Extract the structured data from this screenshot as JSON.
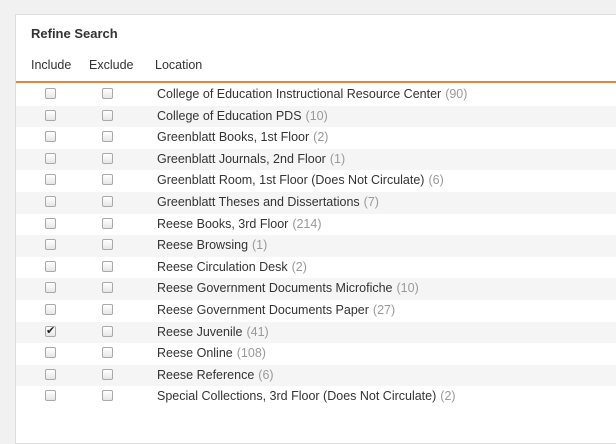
{
  "panel": {
    "title": "Refine Search",
    "columns": {
      "include": "Include",
      "exclude": "Exclude",
      "location": "Location"
    },
    "accent_color": "#e9813f",
    "rows": [
      {
        "label": "College of Education Instructional Resource Center",
        "count": "(90)",
        "include": false,
        "exclude": false
      },
      {
        "label": "College of Education PDS",
        "count": "(10)",
        "include": false,
        "exclude": false
      },
      {
        "label": "Greenblatt Books, 1st Floor",
        "count": "(2)",
        "include": false,
        "exclude": false
      },
      {
        "label": "Greenblatt Journals, 2nd Floor",
        "count": "(1)",
        "include": false,
        "exclude": false
      },
      {
        "label": "Greenblatt Room, 1st Floor (Does Not Circulate)",
        "count": "(6)",
        "include": false,
        "exclude": false
      },
      {
        "label": "Greenblatt Theses and Dissertations",
        "count": "(7)",
        "include": false,
        "exclude": false
      },
      {
        "label": "Reese Books, 3rd Floor",
        "count": "(214)",
        "include": false,
        "exclude": false
      },
      {
        "label": "Reese Browsing",
        "count": "(1)",
        "include": false,
        "exclude": false
      },
      {
        "label": "Reese Circulation Desk",
        "count": "(2)",
        "include": false,
        "exclude": false
      },
      {
        "label": "Reese Government Documents Microfiche",
        "count": "(10)",
        "include": false,
        "exclude": false
      },
      {
        "label": "Reese Government Documents Paper",
        "count": "(27)",
        "include": false,
        "exclude": false
      },
      {
        "label": "Reese Juvenile",
        "count": "(41)",
        "include": true,
        "exclude": false
      },
      {
        "label": "Reese Online",
        "count": "(108)",
        "include": false,
        "exclude": false
      },
      {
        "label": "Reese Reference",
        "count": "(6)",
        "include": false,
        "exclude": false
      },
      {
        "label": "Special Collections, 3rd Floor (Does Not Circulate)",
        "count": "(2)",
        "include": false,
        "exclude": false
      }
    ]
  }
}
